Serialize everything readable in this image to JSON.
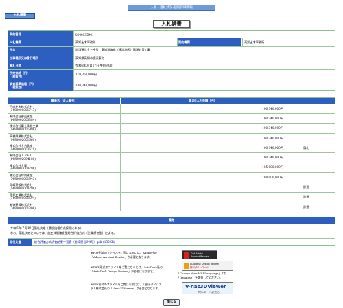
{
  "header": {
    "breadcrumb": "入札・落札状況-個別詳細情報",
    "tag": "入札調書",
    "title": "入札調書"
  },
  "info": {
    "rows": [
      {
        "label": "契約番号",
        "value": "0240135901"
      },
      {
        "label": "入札機関",
        "value": "高知土木事務所",
        "label2": "契約機関",
        "value2": "高知土木事務所"
      },
      {
        "label": "件名",
        "value": "港湾運営６－４号　高知港海岸（横浜地区）高潮対策工事"
      },
      {
        "label": "工事場所又は履行場所",
        "value": "高知県高知市横浜東町"
      },
      {
        "label": "開札日時",
        "value": "令和6年07月17日 午前9:00"
      },
      {
        "label": "予定価格（円）\n（税抜き）",
        "value": "110,350,000円"
      },
      {
        "label": "調査基準価格（円）\n（税抜き）",
        "value": "100,340,000円"
      }
    ]
  },
  "bids": {
    "col1": "業者名（法人番号）",
    "col2": "第1回入札金額（円）",
    "col3": "",
    "rows": [
      {
        "name": "日成土木株式会社",
        "num": "(3490001001747)",
        "amount": "100,340,000円",
        "note": ""
      },
      {
        "name": "有限会社夢山建設",
        "num": "(6490002003384)",
        "amount": "100,340,000円",
        "note": ""
      },
      {
        "name": "株式会社富士建設工業",
        "num": "(1490001001996)",
        "amount": "100,340,000円",
        "note": ""
      },
      {
        "name": "高橋興業株式会社",
        "num": "(9490002001661)",
        "amount": "100,340,000円",
        "note": ""
      },
      {
        "name": "株式会社大谷興産",
        "num": "(1490001003621)",
        "amount": "100,340,000円",
        "note": "落札"
      },
      {
        "name": "有限会社ＩＰＰＯ",
        "num": "(6490002004180)",
        "amount": "100,340,000円",
        "note": ""
      },
      {
        "name": "株式会社大塚",
        "num": "(4490002000796)",
        "amount": "105,000,000円",
        "note": ""
      },
      {
        "name": "株式会社竹内建設",
        "num": "(5490001001943)",
        "amount": "108,000,000円",
        "note": ""
      },
      {
        "name": "尾崎建設株式会社",
        "num": "(1490001000296)",
        "amount": "",
        "note": "辞退"
      },
      {
        "name": "東邦工業株式会社",
        "num": "(7490001001594)",
        "amount": "",
        "note": "辞退"
      },
      {
        "name": "新進建設株式会社",
        "num": "(7490001001306)",
        "amount": "",
        "note": "辞退"
      }
    ]
  },
  "notes": {
    "header": "備考",
    "line1": "令和６年７月19日落札決定（最低価格方式採用による）。",
    "line2": "なお、落札決定については、施工体制確認型総合評価方式（企業評価型）による。",
    "attach_label": "添付文書",
    "attach_link": "総合評価方式評価結果一覧表（港湾運営6-4号）.pdf (155KB)"
  },
  "footer": {
    "pdf_lines": [
      "※PDF形式のファイルをご覧になるには、Adobe社の",
      "「Adobe Acrobat Reader」が必要になります。"
    ],
    "dwf_lines": [
      "※DWF形式のファイルをご覧になるには、AutoDesk社の",
      "「AutoDesk Design Review」が必要になります。"
    ],
    "dwf_extra": [
      "「Choose Your MSI Language」より",
      "「Japanese」を選択してください。"
    ],
    "sfx_lines": [
      "※SFX形式のファイルをご覧になるには、川田テクノシス",
      "テム株式会社の「V-nas3DViewer」が必要となります。"
    ],
    "adobe_banner": [
      "Get Adobe",
      "Acrobat Reader"
    ],
    "autodesk_banner": [
      "Autodesk Design Review",
      "無料ダウンロード"
    ],
    "vnas_banner": [
      "V-nas3DViewer",
      "ダウンロードはこちら"
    ],
    "close_button": "閉じる"
  }
}
